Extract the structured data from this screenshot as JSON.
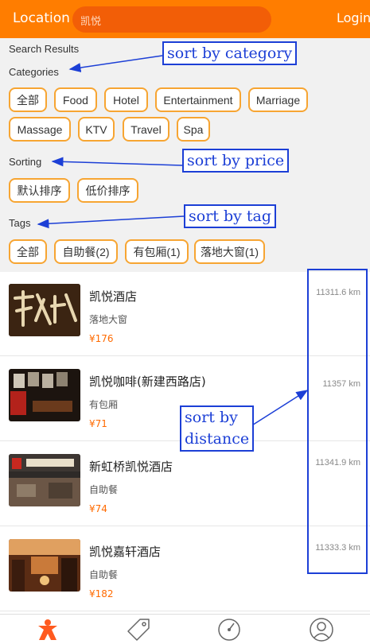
{
  "header": {
    "location_label": "Location",
    "search_value": "凯悦",
    "login_label": "Login"
  },
  "filters": {
    "search_results_label": "Search Results",
    "categories_label": "Categories",
    "categories": [
      "全部",
      "Food",
      "Hotel",
      "Entertainment",
      "Marriage",
      "Massage",
      "KTV",
      "Travel",
      "Spa"
    ],
    "sorting_label": "Sorting",
    "sorting": [
      "默认排序",
      "低价排序"
    ],
    "tags_label": "Tags",
    "tags": [
      "全部",
      "自助餐(2)",
      "有包厢(1)",
      "落地大窗(1)"
    ]
  },
  "annotations": {
    "category": "sort by category",
    "price": "sort by price",
    "tag": "sort by tag",
    "distance_line1": "sort by",
    "distance_line2": "distance"
  },
  "results": [
    {
      "name": "凯悦酒店",
      "tag": "落地大窗",
      "price": "¥176",
      "distance": "11311.6 km"
    },
    {
      "name": "凯悦咖啡(新建西路店)",
      "tag": "有包厢",
      "price": "¥71",
      "distance": "11357 km"
    },
    {
      "name": "新虹桥凯悦酒店",
      "tag": "自助餐",
      "price": "¥74",
      "distance": "11341.9 km"
    },
    {
      "name": "凯悦嘉轩酒店",
      "tag": "自助餐",
      "price": "¥182",
      "distance": "11333.3 km"
    }
  ],
  "bottom_nav": [
    "home-icon",
    "coupon-tag-icon",
    "nearby-compass-icon",
    "profile-icon"
  ],
  "colors": {
    "brand": "#ff7d00",
    "chip_border": "#f7a532",
    "price": "#ff6a00",
    "annotation": "#1c3fd6"
  }
}
